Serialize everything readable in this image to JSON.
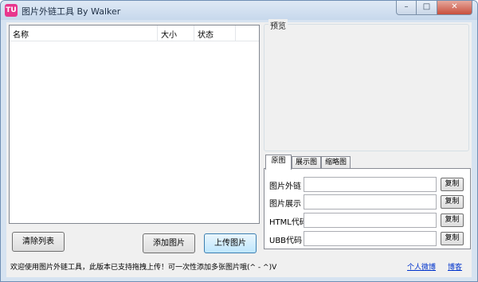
{
  "window": {
    "icon_text": "TU",
    "title": "图片外链工具 By Walker",
    "min_glyph": "–",
    "max_glyph": "□",
    "close_glyph": "✕"
  },
  "list": {
    "columns": [
      "名称",
      "大小",
      "状态"
    ]
  },
  "buttons": {
    "clear": "清除列表",
    "add": "添加图片",
    "upload": "上传图片"
  },
  "preview": {
    "label": "预览"
  },
  "tabs": [
    "原图",
    "展示图",
    "缩略图"
  ],
  "fields": [
    {
      "label": "图片外链",
      "value": "",
      "copy": "复制"
    },
    {
      "label": "图片展示",
      "value": "",
      "copy": "复制"
    },
    {
      "label": "HTML代码",
      "value": "",
      "copy": "复制"
    },
    {
      "label": "UBB代码",
      "value": "",
      "copy": "复制"
    }
  ],
  "status": {
    "message": "欢迎使用图片外链工具，此版本已支持拖拽上传！可一次性添加多张图片哦(^ - ^)V",
    "link_weibo": "个人微博",
    "link_blog": "博客"
  }
}
